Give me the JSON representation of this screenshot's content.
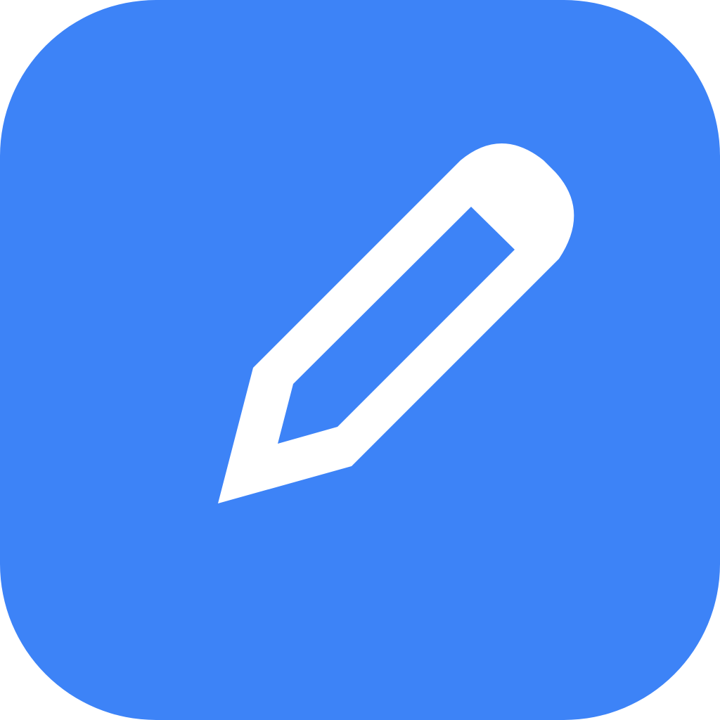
{
  "app_icon": {
    "icon": "pencil-icon",
    "background_color": "#3d83f7",
    "glyph_color": "#ffffff"
  }
}
